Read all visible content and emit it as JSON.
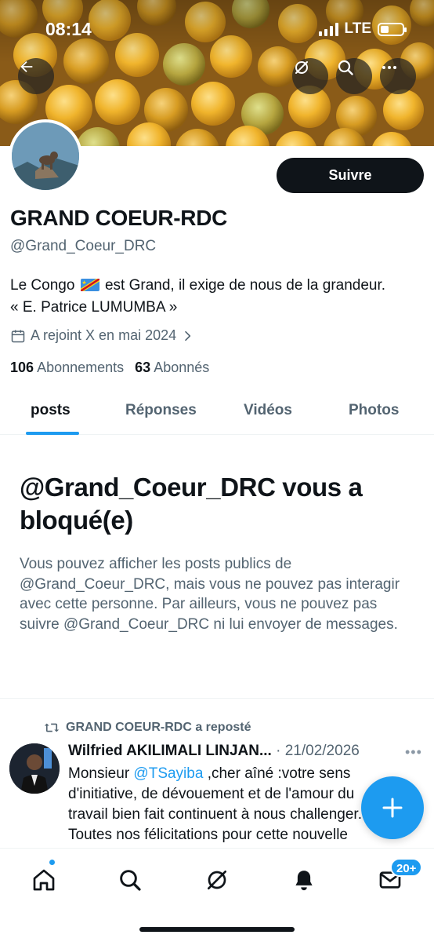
{
  "status_bar": {
    "time": "08:14",
    "network": "LTE"
  },
  "header": {
    "back_icon": "arrow-left-icon",
    "actions": [
      "grok-icon",
      "search-icon",
      "more-icon"
    ]
  },
  "profile": {
    "display_name": "GRAND COEUR-RDC",
    "handle": "@Grand_Coeur_DRC",
    "follow_label": "Suivre",
    "bio_part1": "Le Congo",
    "bio_part2": "est Grand, il exige de nous de la grandeur.",
    "bio_line2": "« E. Patrice LUMUMBA »",
    "joined": "A rejoint X en mai 2024",
    "following_count": "106",
    "following_label": "Abonnements",
    "followers_count": "63",
    "followers_label": "Abonnés"
  },
  "tabs": [
    {
      "label": "posts",
      "active": true
    },
    {
      "label": "Réponses",
      "active": false
    },
    {
      "label": "Vidéos",
      "active": false
    },
    {
      "label": "Photos",
      "active": false
    }
  ],
  "blocked": {
    "title": "@Grand_Coeur_DRC vous a bloqué(e)",
    "text": "Vous pouvez afficher les posts publics de @Grand_Coeur_DRC, mais vous ne pouvez pas interagir avec cette personne. Par ailleurs, vous ne pouvez pas suivre @Grand_Coeur_DRC ni lui envoyer de messages."
  },
  "post": {
    "repost_label": "GRAND COEUR-RDC a reposté",
    "author": "Wilfried AKILIMALI LINJAN...",
    "separator": "·",
    "date": "21/02/2026",
    "more": "•••",
    "text_prefix": "Monsieur ",
    "mention": "@TSayiba",
    "text_line1_rest": " ,cher aîné :votre sens",
    "text_line2": "d'initiative, de dévouement et de l'amour du",
    "text_line3": "travail bien fait continuent à nous challenger.",
    "text_line4": "Toutes nos félicitations pour cette nouvelle"
  },
  "bottom_nav": {
    "items": [
      "home-icon",
      "search-icon",
      "grok-icon",
      "notifications-icon",
      "messages-icon"
    ],
    "messages_badge": "20+"
  },
  "colors": {
    "accent": "#1d9bf0",
    "text": "#0f1419",
    "secondary": "#536471"
  }
}
